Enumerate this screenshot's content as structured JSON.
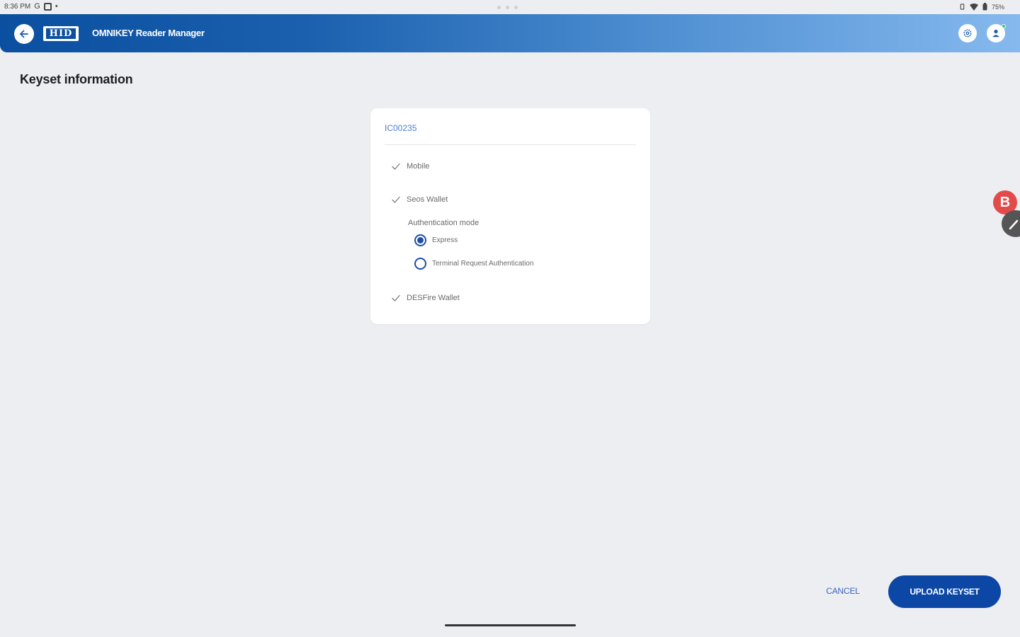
{
  "status_bar": {
    "time": "8:36 PM",
    "battery": "75%"
  },
  "header": {
    "logo_text": "HID",
    "app_title": "OMNIKEY Reader Manager",
    "icons": {
      "back": "arrow-left-icon",
      "settings": "gear-icon",
      "account": "person-icon"
    }
  },
  "page": {
    "title": "Keyset information"
  },
  "card": {
    "keyset_id": "IC00235",
    "items": [
      {
        "label": "Mobile",
        "icon": "check-icon"
      },
      {
        "label": "Seos Wallet",
        "icon": "check-icon"
      },
      {
        "label": "DESFire Wallet",
        "icon": "check-icon"
      }
    ],
    "auth_mode": {
      "label": "Authentication mode",
      "options": [
        {
          "label": "Express",
          "selected": true
        },
        {
          "label": "Terminal Request Authentication",
          "selected": false
        }
      ]
    }
  },
  "floating": {
    "bubble_letter": "B"
  },
  "actions": {
    "cancel": "CANCEL",
    "upload": "UPLOAD KEYSET"
  },
  "colors": {
    "primary": "#0c47a6",
    "accent_text": "#4a7dd8",
    "background": "#edeef2",
    "header_start": "#0b4fa0",
    "header_end": "#86b9ee"
  }
}
